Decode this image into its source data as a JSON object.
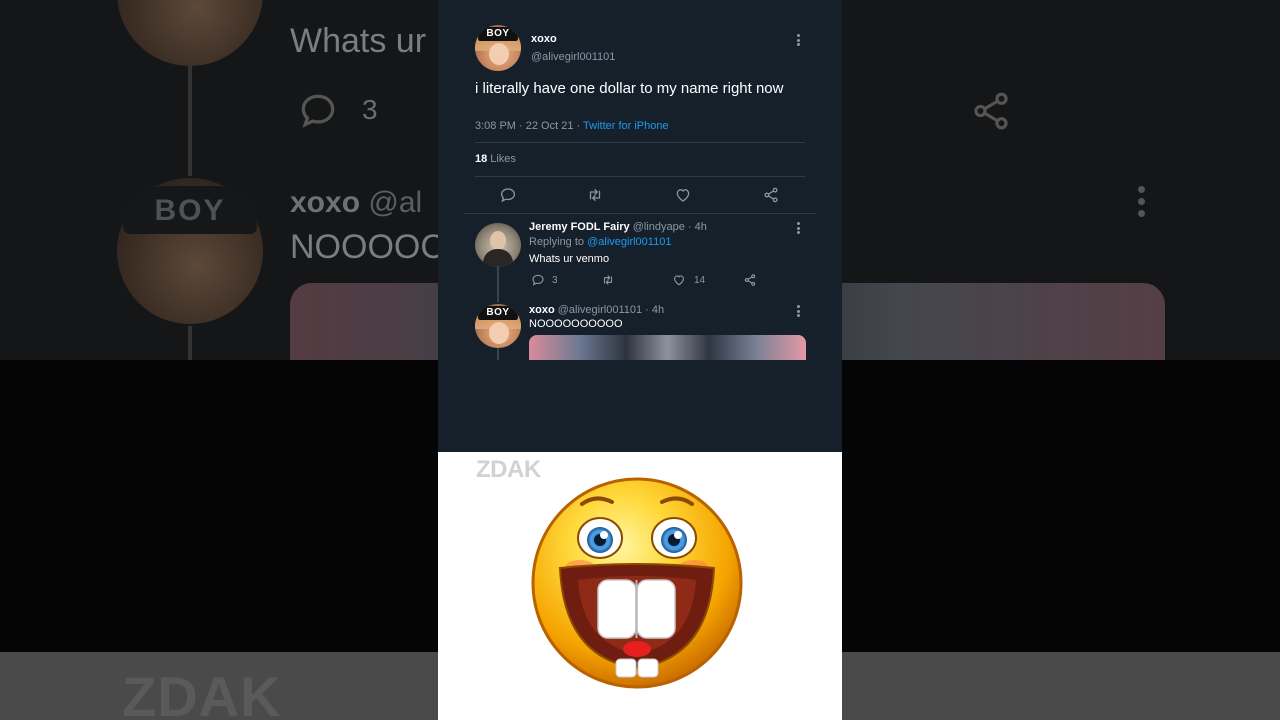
{
  "background": {
    "top_line": "Whats ur",
    "reply_header_name": "xoxo",
    "reply_header_handle": "@al",
    "reply_text": "NOOOOC",
    "reply_count": "3",
    "watermark": "ZDAK",
    "avatar_cap_text": "BOY"
  },
  "tweet": {
    "author_name": "xoxo",
    "author_handle": "@alivegirl001101",
    "avatar_cap_text": "BOY",
    "text": "i literally have one dollar to my name right now",
    "timestamp": "3:08 PM · 22 Oct 21 · ",
    "source": "Twitter for iPhone",
    "likes_count": "18",
    "likes_label": "Likes",
    "actions": [
      "reply-icon",
      "retweet-icon",
      "like-icon",
      "share-icon"
    ]
  },
  "replies": [
    {
      "name": "Jeremy FODL Fairy",
      "handle": "@lindyape · 4h",
      "replying_to_label": "Replying to ",
      "replying_to_handle": "@alivegirl001101",
      "text": "Whats ur venmo",
      "reply_count": "3",
      "retweet_count": "",
      "like_count": "14"
    },
    {
      "name": "xoxo",
      "handle": "@alivegirl001101 · 4h",
      "avatar_cap_text": "BOY",
      "text": "NOOOOOOOOOO"
    }
  ],
  "emoji_panel": {
    "watermark": "ZDAK",
    "emoji": "grinning-buck-teeth-emoji"
  },
  "colors": {
    "panel_bg": "#15202b",
    "link": "#1d9bf0",
    "muted": "#8b98a5",
    "emoji_panel_bg": "#ffffff"
  }
}
